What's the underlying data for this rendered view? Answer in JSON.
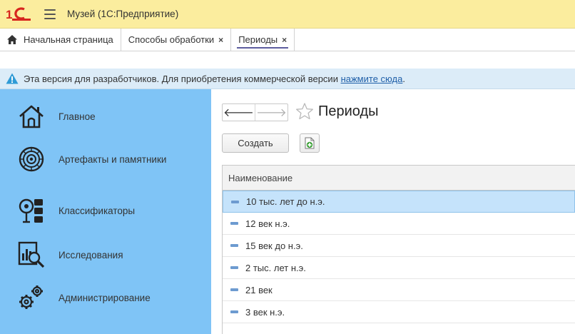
{
  "app": {
    "title": "Музей  (1С:Предприятие)"
  },
  "tabs": [
    {
      "label": "Начальная страница",
      "icon": "home-icon"
    },
    {
      "label": "Способы обработки",
      "close": "×"
    },
    {
      "label": "Периоды",
      "close": "×",
      "active": true
    }
  ],
  "notice": {
    "text": "Эта версия для разработчиков. Для приобретения коммерческой версии ",
    "link": "нажмите сюда",
    "tail": "."
  },
  "sidebar": {
    "items": [
      {
        "label": "Главное",
        "icon": "home-icon"
      },
      {
        "label": "Артефакты и памятники",
        "icon": "rosette-icon"
      },
      {
        "label": "Классификаторы",
        "icon": "classifier-icon"
      },
      {
        "label": "Исследования",
        "icon": "research-icon"
      },
      {
        "label": "Администрирование",
        "icon": "gears-icon"
      }
    ]
  },
  "main": {
    "title": "Периоды",
    "create_label": "Создать",
    "column_header": "Наименование",
    "rows": [
      "10 тыс. лет до н.э.",
      "12 век н.э.",
      "15 век до н.э.",
      "2 тыс. лет н.э.",
      "21 век",
      "3 век н.э."
    ],
    "selected_row": 0
  },
  "colors": {
    "titlebar": "#fbed9e",
    "sidebar": "#7fc4f6",
    "notice": "#dcecf8",
    "selected_row": "#c5e3fb",
    "logo_red": "#d7261e"
  }
}
